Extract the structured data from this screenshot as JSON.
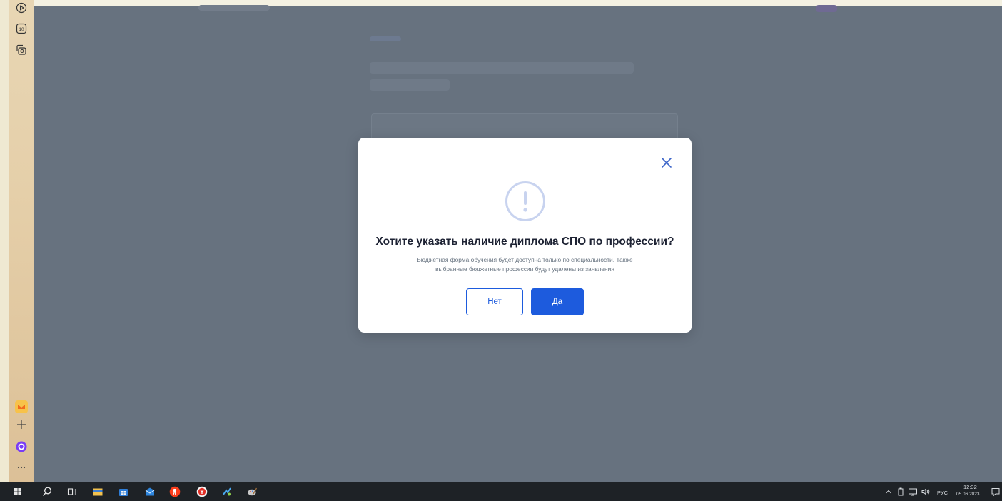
{
  "side_panel": {
    "items": [
      {
        "icon": "play-circle-icon"
      },
      {
        "icon": "ten-badge-icon",
        "label": "10"
      },
      {
        "icon": "screenshot-icon"
      }
    ],
    "bottom": [
      {
        "icon": "app-orange-icon"
      },
      {
        "icon": "plus-icon"
      },
      {
        "icon": "alice-assistant-icon"
      },
      {
        "icon": "more-dots-icon"
      }
    ]
  },
  "modal": {
    "title": "Хотите указать наличие диплома СПО по профессии?",
    "description_line1": "Бюджетная форма обучения будет доступна только по специальности. Также",
    "description_line2": "выбранные бюджетные профессии будут удалены из заявления",
    "no_label": "Нет",
    "yes_label": "Да",
    "colors": {
      "accent": "#1d5bdd",
      "icon_ring": "#c8d3ef"
    }
  },
  "taskbar": {
    "apps": [
      "windows-start-icon",
      "search-icon",
      "task-view-icon",
      "file-manager-icon",
      "store-icon",
      "mail-icon",
      "yandex-icon",
      "yandex-browser-icon",
      "app-sparkle-icon",
      "app-paint-icon"
    ],
    "tray": {
      "language": "РУС",
      "time": "12:32",
      "date": "05.06.2023"
    }
  }
}
